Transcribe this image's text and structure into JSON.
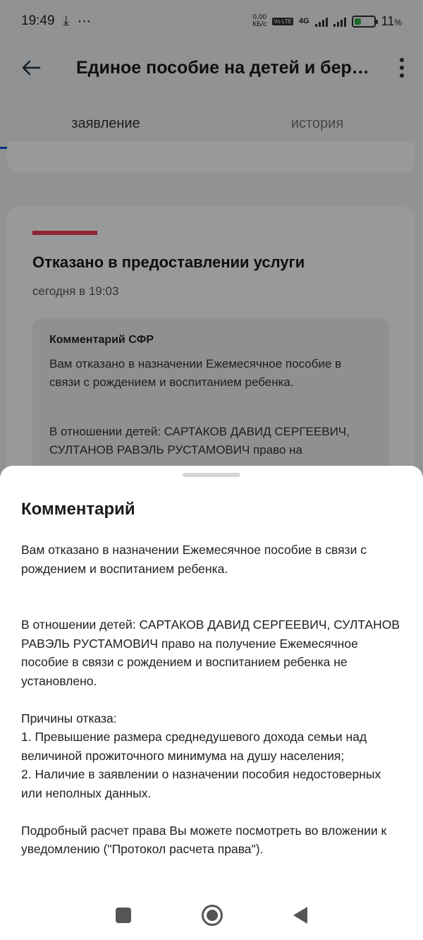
{
  "status_bar": {
    "time": "19:49",
    "net_speed_value": "0,00",
    "net_speed_unit": "КБ/с",
    "volte": "Vo LTE",
    "network": "4G",
    "battery_percent": "11",
    "battery_unit": "%",
    "battery_level": 0.11
  },
  "app_bar": {
    "title": "Единое пособие на детей и бер…"
  },
  "tabs": [
    {
      "label": "заявление",
      "active": true
    },
    {
      "label": "история",
      "active": false
    }
  ],
  "status_card": {
    "title": "Отказано в предоставлении услуги",
    "date": "сегодня в 19:03",
    "comment_header": "Комментарий СФР",
    "comment_p1": "Вам отказано в назначении Ежемесячное пособие в связи с рождением и воспитанием ребенка.",
    "comment_p2": "В отношении детей: САРТАКОВ ДАВИД СЕРГЕЕВИЧ, СУЛТАНОВ РАВЭЛЬ РУСТАМОВИЧ право на"
  },
  "sheet": {
    "title": "Комментарий",
    "p1": "Вам отказано в назначении Ежемесячное пособие в связи с рождением и воспитанием ребенка.",
    "p2": "В отношении детей: САРТАКОВ ДАВИД СЕРГЕЕВИЧ, СУЛТАНОВ РАВЭЛЬ РУСТАМОВИЧ право на получение Ежемесячное пособие в связи с рождением и воспитанием ребенка не установлено.",
    "reasons_header": "Причины отказа:",
    "reason_1": "1. Превышение размера среднедушевого дохода семьи над величиной прожиточного минимума на душу населения;",
    "reason_2": "2. Наличие в заявлении о назначении пособия недостоверных или неполных данных.",
    "p_last": "Подробный расчет права Вы можете посмотреть во вложении к уведомлению (\"Протокол расчета права\")."
  }
}
